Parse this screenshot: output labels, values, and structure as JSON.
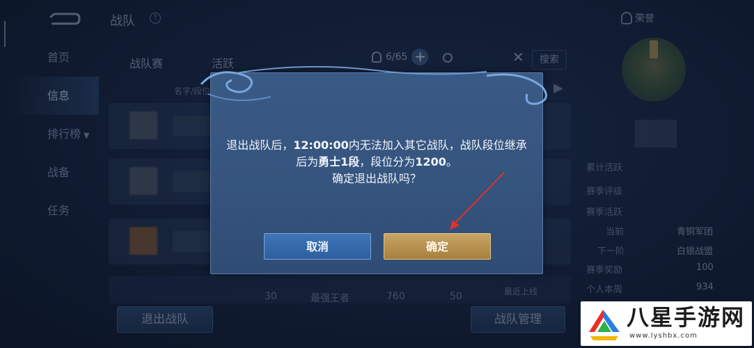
{
  "header": {
    "title": "战队",
    "honor_label": "荣誉"
  },
  "nav": {
    "items": [
      {
        "label": "首页"
      },
      {
        "label": "信息"
      },
      {
        "label": "排行榜"
      },
      {
        "label": "战备"
      },
      {
        "label": "任务"
      }
    ],
    "active_index": 1
  },
  "tabs": {
    "tab1": "战队赛",
    "tab2": "活跃"
  },
  "members": {
    "count": "6/65"
  },
  "search": {
    "button": "搜索"
  },
  "list": {
    "column_header": "名字/段位",
    "visible_stats": [
      "30",
      "最强王者",
      "760",
      "50",
      "最近上线"
    ]
  },
  "bottom": {
    "quit_button": "退出战队",
    "manage_button": "战队管理"
  },
  "right_panel": {
    "labels": [
      "累计活跃",
      "赛季评级",
      "赛季活跃",
      "当前",
      "下一阶",
      "赛季奖励",
      "个人本周"
    ],
    "values": [
      "青铜军团",
      "白银战盟",
      "100",
      "934"
    ]
  },
  "dialog": {
    "message_prefix": "退出战队后，",
    "message_time": "12:00:00",
    "message_mid": "内无法加入其它战队，战队段位继承后为",
    "message_rank": "勇士1段",
    "message_sep": "，段位分为",
    "message_points": "1200",
    "message_end": "。",
    "question": "确定退出战队吗？",
    "cancel_label": "取消",
    "confirm_label": "确定"
  },
  "watermark": {
    "name": "八星手游网",
    "url": "www.lyshbx.com"
  },
  "colors": {
    "confirm_gold": "#b8924f",
    "cancel_blue": "#3668aa",
    "arrow_red": "#e0322c"
  }
}
